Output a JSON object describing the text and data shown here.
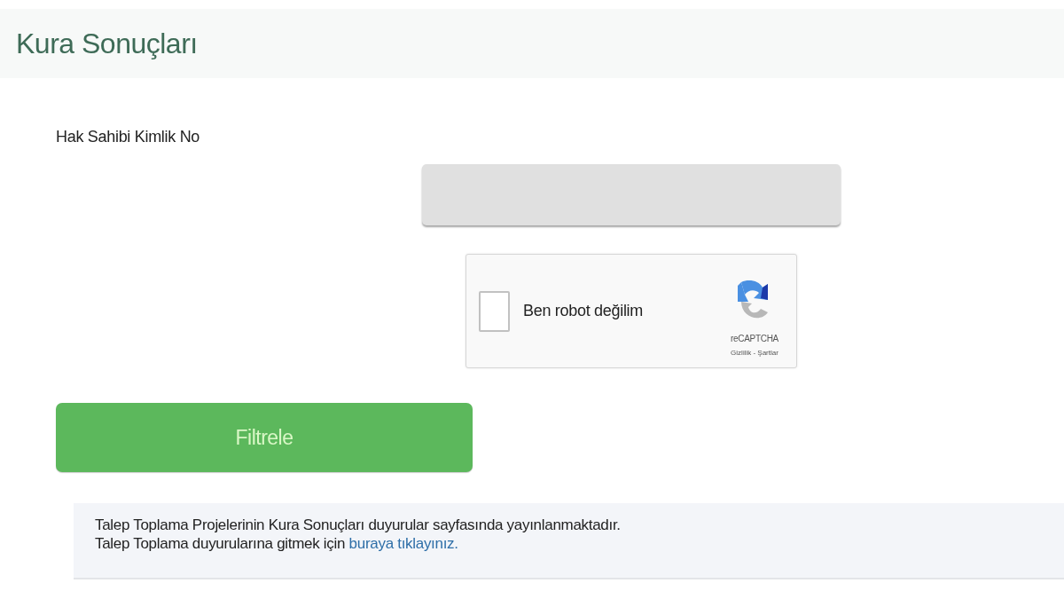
{
  "header": {
    "title": "Kura Sonuçları"
  },
  "form": {
    "field_label": "Hak Sahibi Kimlik No"
  },
  "captcha": {
    "label": "Ben robot değilim",
    "checked": false,
    "brand": "reCAPTCHA",
    "legal": "Gizlilik - Şartlar"
  },
  "filter_button": {
    "label": "Filtrele"
  },
  "notice": {
    "line_1": "Talep Toplama Projelerinin Kura Sonuçları duyurular sayfasında yayınlanmaktadır.",
    "line_2": "Talep Toplama duyurularına gitmek için",
    "link": "buraya tıklayınız."
  }
}
